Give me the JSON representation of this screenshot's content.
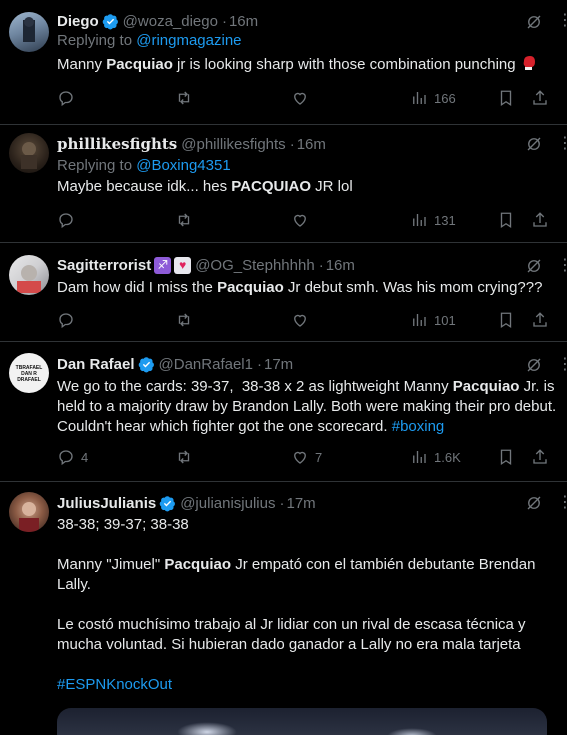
{
  "colors": {
    "accent": "#1d9bf0",
    "muted": "#71767b",
    "text": "#e7e9ea",
    "divider": "#2f3336",
    "verified": "#1d9bf0"
  },
  "tweets": [
    {
      "name": "Diego",
      "verified": true,
      "handle": "@woza_diego",
      "time": "16m",
      "replying_prefix": "Replying to ",
      "replying_to": "@ringmagazine",
      "text_parts": [
        "Manny ",
        "Pacquiao",
        " jr is looking sharp with those combination punching "
      ],
      "emoji": "boxing-glove",
      "views": "166",
      "likes": "",
      "replies": "",
      "reposts": ""
    },
    {
      "name": "phillikesfights",
      "handle": "@phillikesfights",
      "time": "16m",
      "replying_prefix": "Replying to ",
      "replying_to": "@Boxing4351",
      "text_parts": [
        "Maybe because idk... hes ",
        "PACQUIAO",
        " JR lol"
      ],
      "views": "131"
    },
    {
      "name": "Sagitterrorist",
      "handle": "@OG_Stephhhhh",
      "time": "16m",
      "emojis": [
        "sagittarius",
        "heart"
      ],
      "text_parts": [
        "Dam how did I miss the ",
        "Pacquiao",
        " Jr debut smh. Was his mom crying???"
      ],
      "views": "101"
    },
    {
      "name": "Dan Rafael",
      "verified": true,
      "handle": "@DanRafael1",
      "time": "17m",
      "avatar_text": "TBRAFAEL DAN R DRAFAEL",
      "text_parts": [
        "We go to the cards: 39-37,  38-38 x 2 as lightweight Manny ",
        "Pacquiao",
        " Jr. is held to a majority draw by Brandon Lally. Both were making their pro debut. Couldn't hear which fighter got the one scorecard. ",
        "#boxing"
      ],
      "replies": "4",
      "likes": "7",
      "views": "1.6K"
    },
    {
      "name": "JuliusJulianis",
      "verified": true,
      "handle": "@julianisjulius",
      "time": "17m",
      "line1": "38-38; 39-37; 38-38",
      "text_parts": [
        "Manny \"Jimuel\" ",
        "Pacquiao",
        " Jr empató con el también debutante Brendan Lally."
      ],
      "para3": "Le costó muchísimo trabajo al Jr lidiar con un rival de escasa técnica y mucha voluntad. Si hubieran dado ganador a Lally no era mala tarjeta",
      "hashtag": "#ESPNKnockOut"
    }
  ],
  "icons": [
    "reply-icon",
    "repost-icon",
    "like-icon",
    "views-icon",
    "bookmark-icon",
    "share-icon",
    "grok-icon",
    "more-icon"
  ]
}
